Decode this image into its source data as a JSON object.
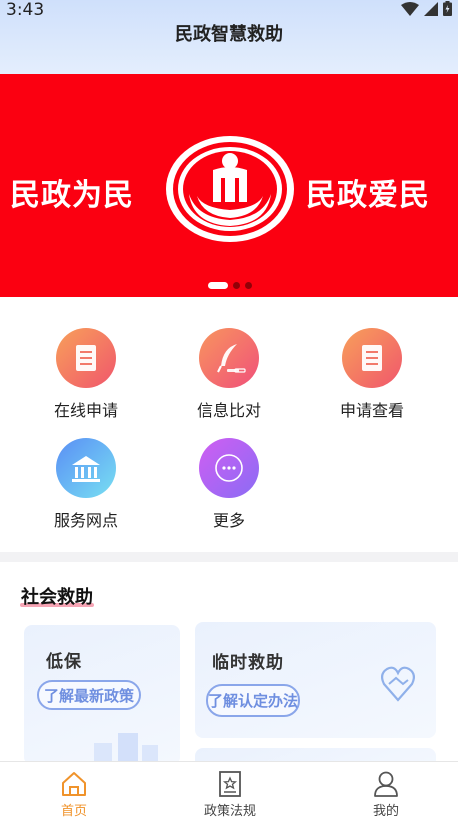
{
  "status_bar": {
    "time": "3:43"
  },
  "header": {
    "title": "民政智慧救助"
  },
  "banner": {
    "left_text": "民政为民",
    "right_text": "民政爱民",
    "slide_count": 3,
    "active_slide": 1
  },
  "services": [
    {
      "label": "在线申请",
      "icon": "document-icon"
    },
    {
      "label": "信息比对",
      "icon": "quill-icon"
    },
    {
      "label": "申请查看",
      "icon": "document-icon"
    },
    {
      "label": "服务网点",
      "icon": "bank-icon"
    },
    {
      "label": "更多",
      "icon": "more-icon"
    }
  ],
  "social_aid": {
    "title": "社会救助",
    "cards": [
      {
        "title": "低保",
        "button": "了解最新政策"
      },
      {
        "title": "临时救助",
        "button": "了解认定办法",
        "icon": "handshake-heart-icon"
      }
    ]
  },
  "bottom_nav": {
    "items": [
      {
        "label": "首页",
        "icon": "home-icon",
        "active": true
      },
      {
        "label": "政策法规",
        "icon": "policy-book-icon",
        "active": false
      },
      {
        "label": "我的",
        "icon": "user-icon",
        "active": false
      }
    ]
  },
  "colors": {
    "banner_red": "#fb0011",
    "accent_orange": "#f0932b",
    "pill_blue": "#6f8fe0"
  }
}
